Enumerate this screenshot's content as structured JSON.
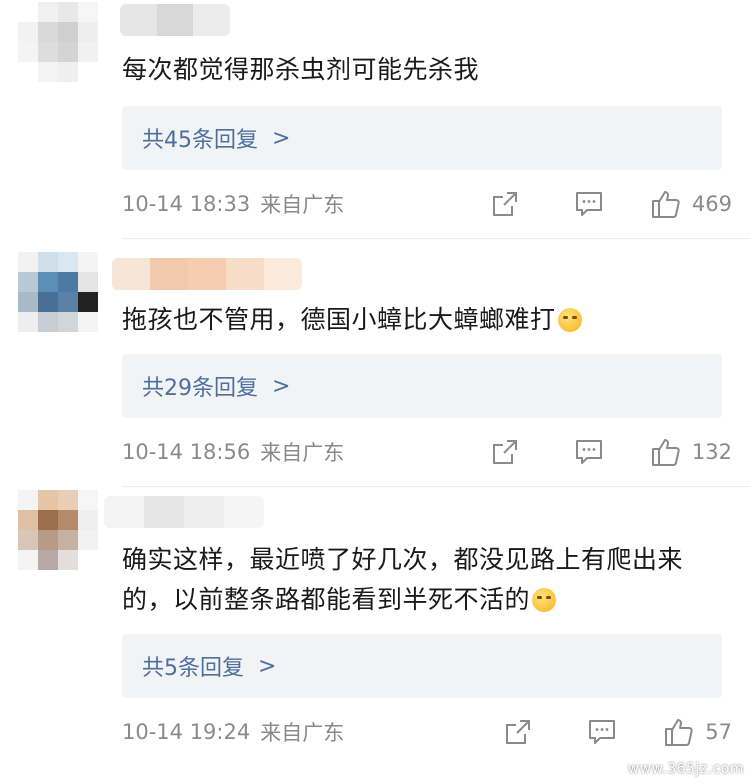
{
  "comments": [
    {
      "text": "每次都觉得那杀虫剂可能先杀我",
      "reply_label": "共45条回复",
      "reply_chevron": ">",
      "time": "10-14 18:33",
      "source": "来自广东",
      "likes": "469"
    },
    {
      "text": "拖孩也不管用，德国小蟑比大蟑螂难打",
      "reply_label": "共29条回复",
      "reply_chevron": ">",
      "time": "10-14 18:56",
      "source": "来自广东",
      "likes": "132"
    },
    {
      "text": "确实这样，最近喷了好几次，都没见路上有爬出来的，以前整条路都能看到半死不活的",
      "reply_label": "共5条回复",
      "reply_chevron": ">",
      "time": "10-14 19:24",
      "source": "来自广东",
      "likes": "57"
    }
  ],
  "icons": {
    "share": "share-icon",
    "comment": "comment-icon",
    "like": "thumbs-up-icon"
  },
  "colors": {
    "link": "#4d6f9f",
    "meta": "#8a8a8a",
    "reply_bg": "#f2f3f5"
  },
  "watermark": "www.365jz.com"
}
